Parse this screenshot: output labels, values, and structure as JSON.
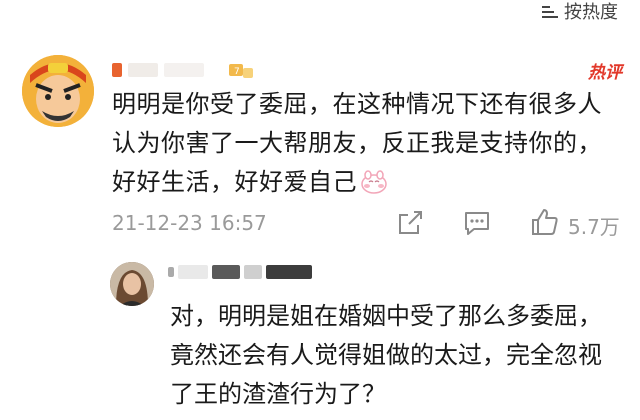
{
  "sort": {
    "label": "按热度",
    "icon": "sort-lines-icon"
  },
  "comment": {
    "hot_badge": "热评",
    "text": "明明是你受了委屈，在这种情况下还有很多人认为你害了一大帮朋友，反正我是支持你的，好好生活，好好爱自己",
    "emoji": "blush-face-emoji",
    "timestamp": "21-12-23 16:57",
    "like_count": "5.7万"
  },
  "reply": {
    "text": "对，明明是姐在婚姻中受了那么多委屈，竟然还会有人觉得姐做的太过，完全忽视了王的渣渣行为了？"
  },
  "colors": {
    "hot": "#e2382a",
    "meta": "#9a9a9a",
    "text": "#1a1a1a"
  }
}
